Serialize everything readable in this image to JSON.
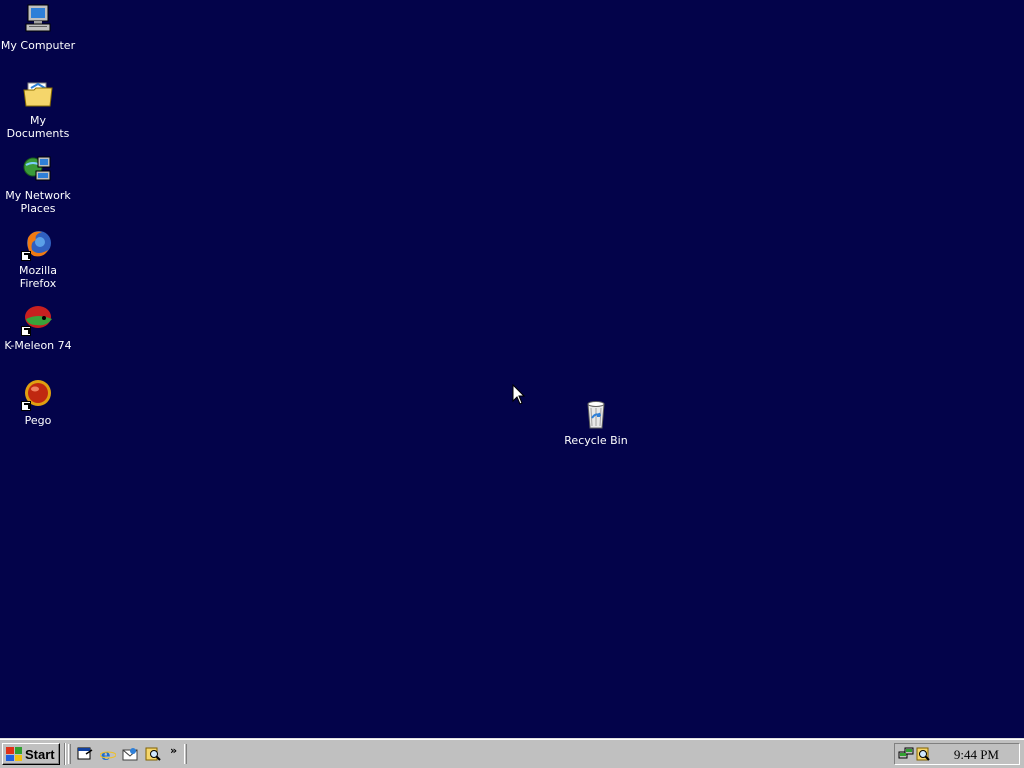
{
  "desktop": {
    "background_color": "#03034a",
    "icons": [
      {
        "id": "my-computer",
        "label": "My Computer",
        "icon": "computer-icon",
        "shortcut": false
      },
      {
        "id": "my-documents",
        "label": "My Documents",
        "icon": "documents-folder-icon",
        "shortcut": false
      },
      {
        "id": "my-network-places",
        "label": "My Network Places",
        "icon": "network-places-icon",
        "shortcut": false
      },
      {
        "id": "mozilla-firefox",
        "label": "Mozilla Firefox",
        "icon": "firefox-icon",
        "shortcut": true
      },
      {
        "id": "k-meleon",
        "label": "K-Meleon 74",
        "icon": "k-meleon-icon",
        "shortcut": true
      },
      {
        "id": "pego",
        "label": "Pego",
        "icon": "pego-icon",
        "shortcut": true
      },
      {
        "id": "recycle-bin",
        "label": "Recycle Bin",
        "icon": "recycle-bin-icon",
        "shortcut": false
      }
    ]
  },
  "taskbar": {
    "start_label": "Start",
    "quick_launch": [
      "show-desktop-icon",
      "internet-explorer-icon",
      "outlook-express-icon",
      "search-icon"
    ],
    "overflow_label": "»",
    "tray_icons": [
      "network-tray-icon",
      "search-tray-icon"
    ],
    "clock": "9:44 PM"
  }
}
